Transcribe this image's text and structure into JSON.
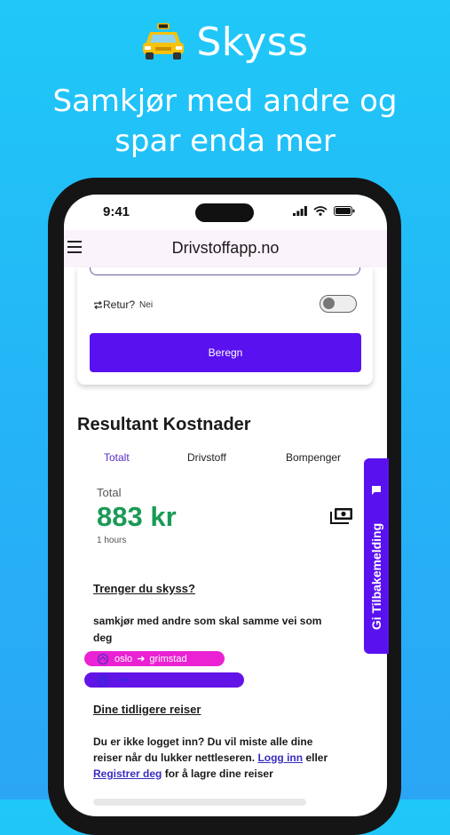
{
  "promo": {
    "title": "Skyss",
    "subtitle": "Samkjør med andre og spar enda mer"
  },
  "status_bar": {
    "time": "9:41"
  },
  "app_bar": {
    "title": "Drivstoffapp.no",
    "menu_icon": "hamburger-menu-icon"
  },
  "form": {
    "retur_label": "Retur?",
    "retur_value": "Nei",
    "retur_toggle_on": false,
    "calculate_label": "Beregn"
  },
  "results": {
    "title": "Resultant Kostnader",
    "tabs": [
      {
        "label": "Totalt",
        "active": true
      },
      {
        "label": "Drivstoff",
        "active": false
      },
      {
        "label": "Bompenger",
        "active": false
      }
    ],
    "total_label": "Total",
    "total_value": "883 kr",
    "duration": "1 hours"
  },
  "rideshare": {
    "heading": "Trenger du skyss?",
    "description": "samkjør med andre som skal samme vei som deg",
    "routes": [
      {
        "from": "oslo",
        "to": "grimstad"
      },
      {
        "from": "",
        "to": ""
      }
    ]
  },
  "history": {
    "heading": "Dine tidligere reiser",
    "text_before": "Du er ikke logget inn? Du vil miste alle dine reiser når du lukker nettleseren.",
    "login_link": "Logg inn",
    "middle": "eller",
    "register_link": "Registrer deg",
    "text_after": "for å lagre dine reiser"
  },
  "feedback": {
    "label": "Gi Tilbakemelding"
  },
  "colors": {
    "background_top": "#1fc8f7",
    "accent": "#5a11f0",
    "total_green": "#1a9a55",
    "chip_pink": "#ea22d3"
  }
}
